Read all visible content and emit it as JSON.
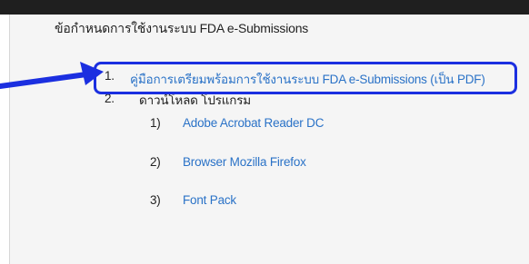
{
  "heading": "ข้อกำหนดการใช้งานระบบ FDA e-Submissions",
  "list": [
    {
      "number": "1.",
      "text": "คู่มือการเตรียมพร้อมการใช้งานระบบ FDA e-Submissions (เป็น PDF)"
    },
    {
      "number": "2.",
      "text": "ดาวน์โหลด โปรแกรม"
    }
  ],
  "downloads": [
    {
      "number": "1)",
      "text": "Adobe Acrobat Reader DC"
    },
    {
      "number": "2)",
      "text": "Browser Mozilla Firefox"
    },
    {
      "number": "3)",
      "text": "Font Pack"
    }
  ],
  "colors": {
    "link": "#2a72c7",
    "highlight": "#1b2fe0",
    "arrow": "#1b2fe0"
  },
  "annotations": {
    "arrow_icon": "arrow-pointer-icon"
  }
}
